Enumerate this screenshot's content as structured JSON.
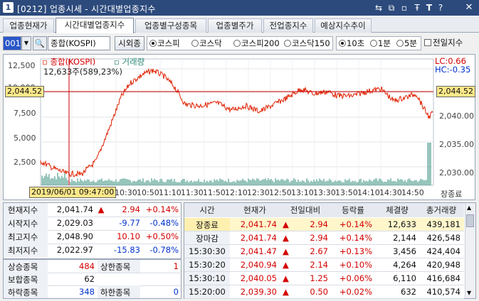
{
  "window": {
    "code": "1",
    "title": "[0212] 업종시세 - 시간대별업종지수",
    "icons": [
      "transfer-icon",
      "copy-icon",
      "restore-icon",
      "pin-icon",
      "text-icon",
      "help-icon",
      "close-icon"
    ]
  },
  "tabs": [
    "업종현재가",
    "시간대별업종지수",
    "업종별구성종목",
    "업종별주가",
    "전업종지수",
    "예상지수추이"
  ],
  "active_tab": "시간대별업종지수",
  "toolbar": {
    "code": "001",
    "index_name": "종합(KOSPI)",
    "overseas_button": "시외종",
    "markets": [
      "코스피",
      "코스닥",
      "코스피200",
      "코스닥150"
    ],
    "market_selected": "코스피",
    "intervals": [
      "10초",
      "1분",
      "5분"
    ],
    "interval_selected": "10초",
    "prev_day_label": "전일지수"
  },
  "chart": {
    "legend_main": "종합(KOSPI)",
    "legend_volume": "거래량",
    "cursor_info": "12,633주(589,23%)",
    "lc_label": "LC:0.66",
    "hc_label": "HC:-0.35",
    "left_ticks": [
      "12,500",
      "10,000",
      "7,500",
      "5,000",
      "2,500"
    ],
    "right_ticks": [
      "2,040.00",
      "2,035.00",
      "2,030.00"
    ],
    "current_left": "2,044.52",
    "current_right": "2,044.52",
    "cursor_time": "2019/06/01 09:47:00",
    "x_ticks": [
      "10:30",
      "10:50",
      "11:10",
      "11:30",
      "11:50",
      "12:10",
      "12:30",
      "12:50",
      "13:10",
      "13:30",
      "13:50",
      "14:10",
      "14:30",
      "14:50"
    ],
    "close_label": "장종료",
    "colors": {
      "line": "#e02000",
      "volume": "#2e8b7a",
      "hline": "#cc0000"
    }
  },
  "summary": {
    "rows": [
      {
        "label": "현재지수",
        "value": "2,041.74",
        "arrow": "▲",
        "change": "2.94",
        "pct": "+0.14%"
      },
      {
        "label": "시작지수",
        "value": "2,029.03",
        "arrow": "",
        "change": "-9.77",
        "pct": "-0.48%"
      },
      {
        "label": "최고지수",
        "value": "2,048.90",
        "arrow": "",
        "change": "10.10",
        "pct": "+0.50%"
      },
      {
        "label": "최저지수",
        "value": "2,022.97",
        "arrow": "",
        "change": "-15.83",
        "pct": "-0.78%"
      }
    ]
  },
  "breadth": {
    "rows": [
      {
        "l1": "상승종목",
        "v1": "484",
        "l2": "상한종목",
        "v2": "1"
      },
      {
        "l1": "보합종목",
        "v1": "62",
        "l2": "",
        "v2": ""
      },
      {
        "l1": "하락종목",
        "v1": "348",
        "l2": "하한종목",
        "v2": "0"
      }
    ]
  },
  "table": {
    "headers": [
      "시간",
      "현재가",
      "전일대비",
      "등락률",
      "체결량",
      "총거래량"
    ],
    "rows": [
      {
        "time": "장종료",
        "price": "2,041.74",
        "arrow": "▲",
        "diff": "2.94",
        "rate": "+0.14%",
        "qty": "12,633",
        "total": "439,181"
      },
      {
        "time": "장마감",
        "price": "2,041.74",
        "arrow": "▲",
        "diff": "2.94",
        "rate": "+0.14%",
        "qty": "2,144",
        "total": "426,548"
      },
      {
        "time": "15:30:30",
        "price": "2,041.47",
        "arrow": "▲",
        "diff": "2.67",
        "rate": "+0.13%",
        "qty": "3,456",
        "total": "424,404"
      },
      {
        "time": "15:30:20",
        "price": "2,040.94",
        "arrow": "▲",
        "diff": "2.14",
        "rate": "+0.10%",
        "qty": "4,264",
        "total": "420,948"
      },
      {
        "time": "15:30:10",
        "price": "2,040.05",
        "arrow": "▲",
        "diff": "1.25",
        "rate": "+0.06%",
        "qty": "6,110",
        "total": "416,684"
      },
      {
        "time": "15:20:00",
        "price": "2,039.30",
        "arrow": "▲",
        "diff": "0.50",
        "rate": "+0.02%",
        "qty": "632",
        "total": "410,574"
      }
    ]
  }
}
